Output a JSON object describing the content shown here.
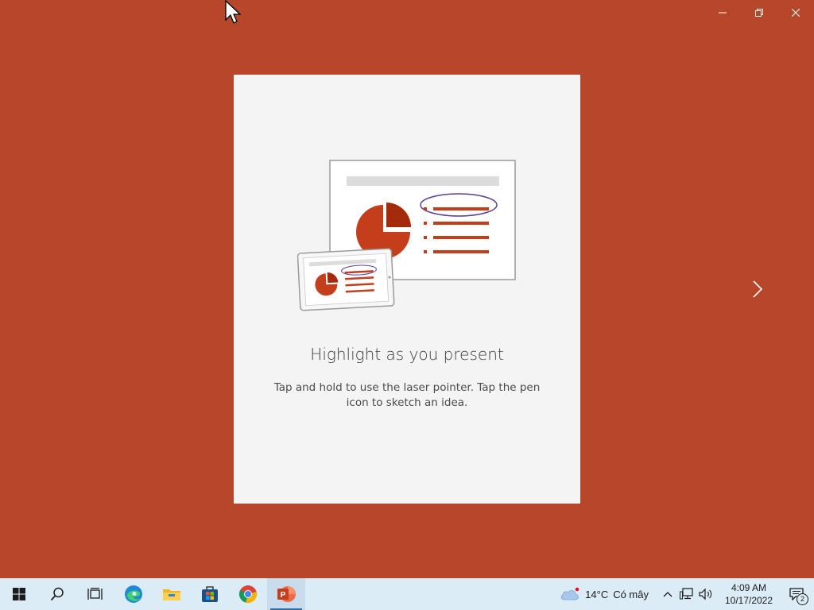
{
  "window": {
    "controls": [
      "minimize",
      "restore",
      "close"
    ]
  },
  "card": {
    "title": "Highlight as you present",
    "description": "Tap and hold to use the laser pointer. Tap the pen icon to sketch an idea."
  },
  "taskbar": {
    "apps": [
      {
        "name": "start",
        "icon": "windows-logo-icon"
      },
      {
        "name": "search",
        "icon": "search-icon"
      },
      {
        "name": "task-view",
        "icon": "task-view-icon"
      },
      {
        "name": "edge",
        "icon": "edge-icon"
      },
      {
        "name": "file-explorer",
        "icon": "folder-icon"
      },
      {
        "name": "store",
        "icon": "store-icon"
      },
      {
        "name": "chrome",
        "icon": "chrome-icon"
      },
      {
        "name": "powerpoint",
        "icon": "powerpoint-icon",
        "active": true
      }
    ],
    "weather": {
      "temp": "14°C",
      "condition": "Có mây"
    },
    "clock": {
      "time": "4:09 AM",
      "date": "10/17/2022"
    },
    "notifications": {
      "count": "2"
    }
  },
  "colors": {
    "background": "#b7472a",
    "card": "#f4f4f4",
    "accent": "#c43e1c",
    "taskbar": "#dcecf7"
  }
}
